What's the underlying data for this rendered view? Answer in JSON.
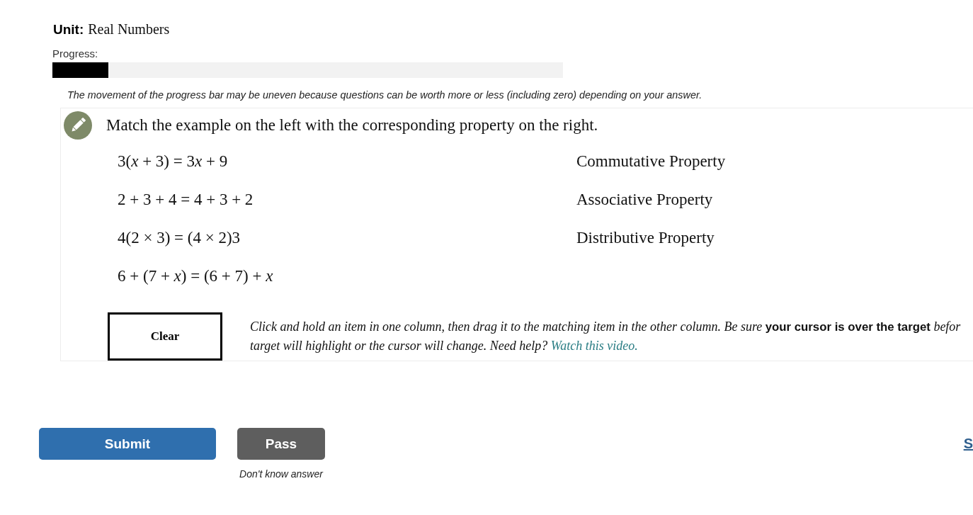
{
  "unit": {
    "label": "Unit:",
    "value": "Real Numbers"
  },
  "progress": {
    "label": "Progress:",
    "level": 0.11,
    "note": "The movement of the progress bar may be uneven because questions can be worth more or less (including zero) depending on your answer."
  },
  "question": {
    "prompt": "Match the example on the left with the corresponding property on the right.",
    "examples": [
      "3(x + 3) = 3x + 9",
      "2 + 3 + 4 = 4 + 3 + 2",
      "4(2 × 3) = (4 × 2)3",
      "6 + (7 + x) = (6 + 7) + x"
    ],
    "properties": [
      "Commutative Property",
      "Associative Property",
      "Distributive Property"
    ],
    "clear_button": "Clear",
    "instructions": {
      "line_1": "Click and hold an item in one column, then drag it to the matching item in the other column. Be sure **your cursor is over the target** befor",
      "line_2": "target will highlight or the cursor will change. Need help?",
      "link": "Watch this video."
    }
  },
  "actions": {
    "submit": "Submit",
    "pass": "Pass",
    "pass_hint": "Don't know answer",
    "link": "S"
  }
}
